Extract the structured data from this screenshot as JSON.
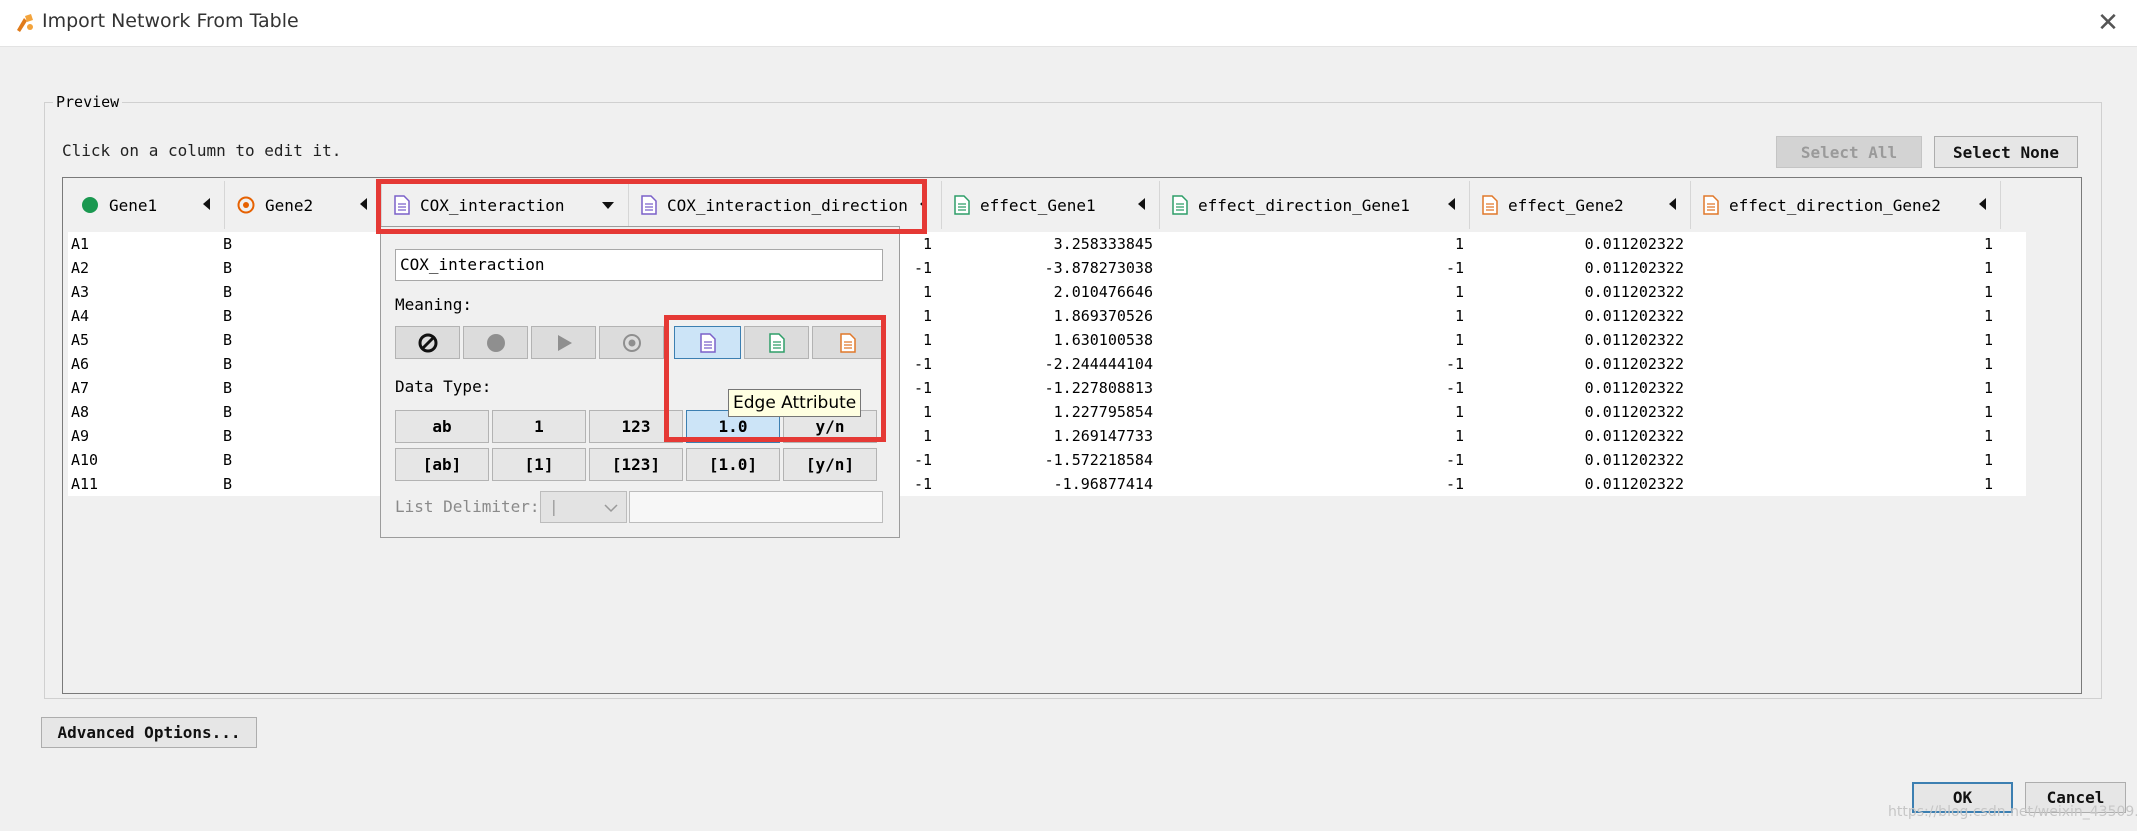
{
  "window": {
    "title": "Import Network From Table"
  },
  "preview": {
    "legend": "Preview",
    "hint": "Click on a column to edit it.",
    "select_all": "Select All",
    "select_none": "Select None"
  },
  "columns": [
    {
      "name": "Gene1",
      "icon": "source-node-icon"
    },
    {
      "name": "Gene2",
      "icon": "target-node-icon"
    },
    {
      "name": "COX_interaction",
      "icon": "edge-attribute-icon"
    },
    {
      "name": "COX_interaction_direction",
      "icon": "edge-attribute-icon"
    },
    {
      "name": "effect_Gene1",
      "icon": "source-node-attribute-icon"
    },
    {
      "name": "effect_direction_Gene1",
      "icon": "source-node-attribute-icon"
    },
    {
      "name": "effect_Gene2",
      "icon": "target-node-attribute-icon"
    },
    {
      "name": "effect_direction_Gene2",
      "icon": "target-node-attribute-icon"
    }
  ],
  "rows": [
    [
      "A1",
      "B",
      "1",
      "3.258333845",
      "1",
      "0.011202322",
      "1"
    ],
    [
      "A2",
      "B",
      "-1",
      "-3.878273038",
      "-1",
      "0.011202322",
      "1"
    ],
    [
      "A3",
      "B",
      "1",
      "2.010476646",
      "1",
      "0.011202322",
      "1"
    ],
    [
      "A4",
      "B",
      "1",
      "1.869370526",
      "1",
      "0.011202322",
      "1"
    ],
    [
      "A5",
      "B",
      "1",
      "1.630100538",
      "1",
      "0.011202322",
      "1"
    ],
    [
      "A6",
      "B",
      "-1",
      "-2.244444104",
      "-1",
      "0.011202322",
      "1"
    ],
    [
      "A7",
      "B",
      "-1",
      "-1.227808813",
      "-1",
      "0.011202322",
      "1"
    ],
    [
      "A8",
      "B",
      "1",
      "1.227795854",
      "1",
      "0.011202322",
      "1"
    ],
    [
      "A9",
      "B",
      "1",
      "1.269147733",
      "1",
      "0.011202322",
      "1"
    ],
    [
      "A10",
      "B",
      "-1",
      "-1.572218584",
      "-1",
      "0.011202322",
      "1"
    ],
    [
      "A11",
      "B",
      "-1",
      "-1.96877414",
      "-1",
      "0.011202322",
      "1"
    ]
  ],
  "popup": {
    "column_name": "COX_interaction",
    "meaning_label": "Meaning:",
    "data_type_label": "Data Type:",
    "data_types_row1": [
      "ab",
      "1",
      "123",
      "1.0",
      "y/n"
    ],
    "data_types_row2": [
      "[ab]",
      "[1]",
      "[123]",
      "[1.0]",
      "[y/n]"
    ],
    "list_delimiter_label": "List Delimiter:",
    "list_delimiter_value": "|",
    "tooltip": "Edge Attribute"
  },
  "footer": {
    "advanced_options": "Advanced Options...",
    "ok": "OK",
    "cancel": "Cancel",
    "watermark": "https://blog.csdn.net/weixin_43509..."
  },
  "colors": {
    "source": "#1a9850",
    "target": "#e66101",
    "edge": "#7b61c9",
    "node_attr": "#2e9e68",
    "target_attr": "#e0782a",
    "highlight": "#e53935"
  }
}
